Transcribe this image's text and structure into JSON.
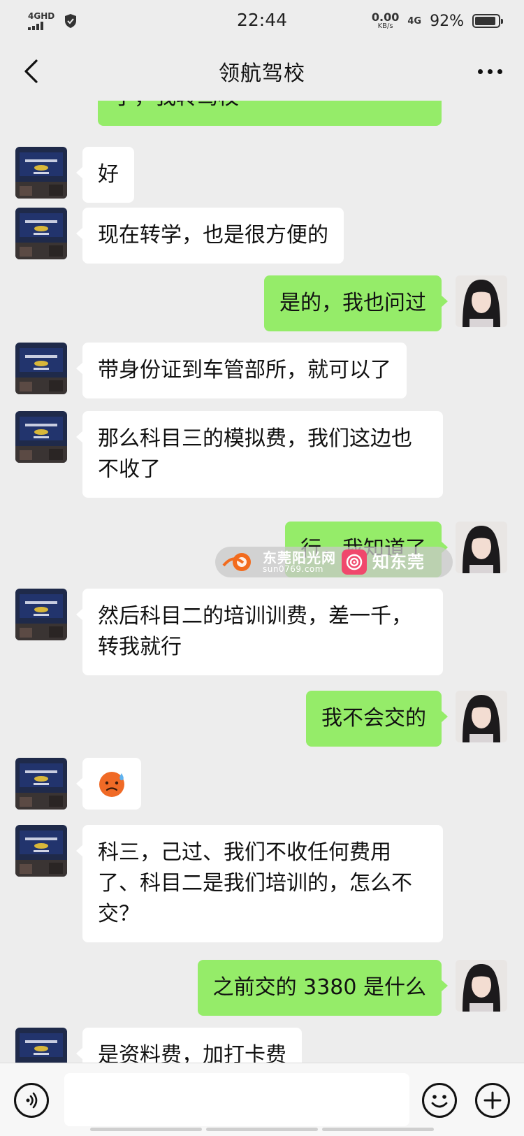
{
  "status_bar": {
    "network": "4GHD",
    "time": "22:44",
    "speed_value": "0.00",
    "speed_unit": "KB/s",
    "network_4g": "4G",
    "battery_percent": "92%",
    "battery_level": 0.92
  },
  "header": {
    "title": "领航驾校"
  },
  "messages": [
    {
      "side": "right",
      "text": "了，我转驾校",
      "partial": true
    },
    {
      "side": "left",
      "text": "好"
    },
    {
      "side": "left",
      "text": "现在转学，也是很方便的"
    },
    {
      "side": "right",
      "text": "是的，我也问过"
    },
    {
      "side": "left",
      "text": "带身份证到车管部所，就可以了"
    },
    {
      "side": "left",
      "text": "那么科目三的模拟费，我们这边也不收了"
    },
    {
      "side": "right",
      "text": "行，我知道了"
    },
    {
      "side": "left",
      "text": "然后科目二的培训训费，差一千，转我就行"
    },
    {
      "side": "right",
      "text": "我不会交的"
    },
    {
      "side": "left",
      "text": "",
      "emoji": "sweat-face-emoji"
    },
    {
      "side": "left",
      "text": "科三，己过、我们不收任何费用了、科目二是我们培训的，怎么不交？"
    },
    {
      "side": "right",
      "text": "之前交的 3380 是什么"
    },
    {
      "side": "left",
      "text": "是资料费，加打卡费",
      "partial": true
    }
  ],
  "watermark": {
    "site_name": "东莞阳光网",
    "site_url": "sun0769.com",
    "app_name": "知东莞"
  },
  "colors": {
    "background": "#ededed",
    "sent_bubble": "#95ec69",
    "received_bubble": "#ffffff"
  }
}
